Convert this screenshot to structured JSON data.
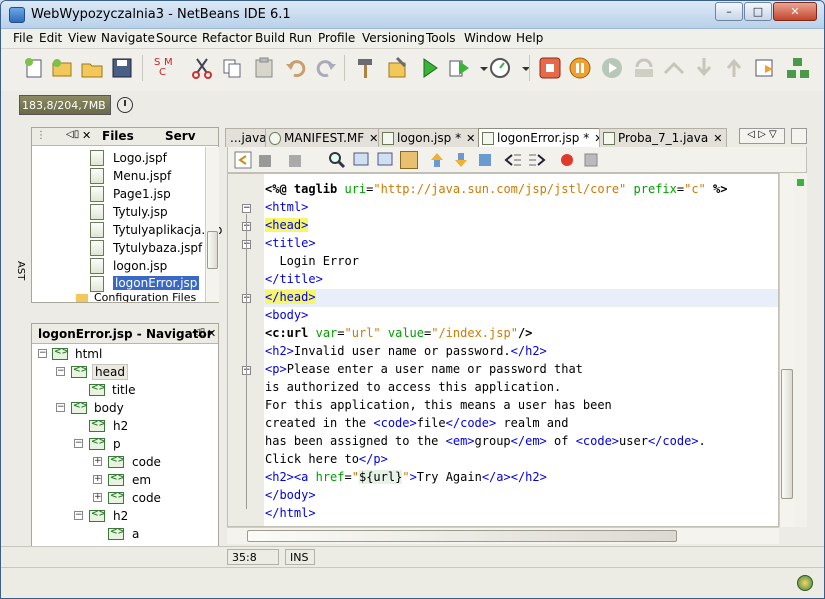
{
  "window": {
    "title": "WebWypozyczalnia3 - NetBeans IDE 6.1",
    "min": "–",
    "max": "□",
    "close": "✕"
  },
  "menu": [
    "File",
    "Edit",
    "View",
    "Navigate",
    "Source",
    "Refactor",
    "Build",
    "Run",
    "Profile",
    "Versioning",
    "Tools",
    "Window",
    "Help"
  ],
  "toolbar": {
    "memory": "183,8/204,7MB",
    "smc_s": "S",
    "smc_m": "M",
    "smc_c": "C"
  },
  "left_strip": {
    "label": "AST"
  },
  "files_panel": {
    "tabs": [
      "Files",
      "Serv"
    ],
    "items": [
      "Logo.jspf",
      "Menu.jspf",
      "Page1.jsp",
      "Tytuly.jsp",
      "Tytulyaplikacja.jsp",
      "Tytulybaza.jspf",
      "logon.jsp",
      "logonError.jsp",
      "Configuration Files"
    ],
    "selected": "logonError.jsp"
  },
  "navigator": {
    "title": "logonError.jsp - Navigator",
    "nodes": [
      "html",
      "head",
      "title",
      "body",
      "h2",
      "p",
      "code",
      "em",
      "code",
      "h2",
      "a"
    ]
  },
  "editor_tabs": [
    {
      "label": "...java",
      "active": false
    },
    {
      "label": "MANIFEST.MF",
      "active": false
    },
    {
      "label": "logon.jsp *",
      "active": false
    },
    {
      "label": "logonError.jsp *",
      "active": true
    },
    {
      "label": "Proba_7_1.java",
      "active": false
    }
  ],
  "status": {
    "position": "35:8",
    "mode": "INS"
  },
  "colors": {
    "tag": "#0000e6",
    "attr": "#00a000",
    "string": "#ce7b00",
    "highlight": "#f6f66a"
  }
}
